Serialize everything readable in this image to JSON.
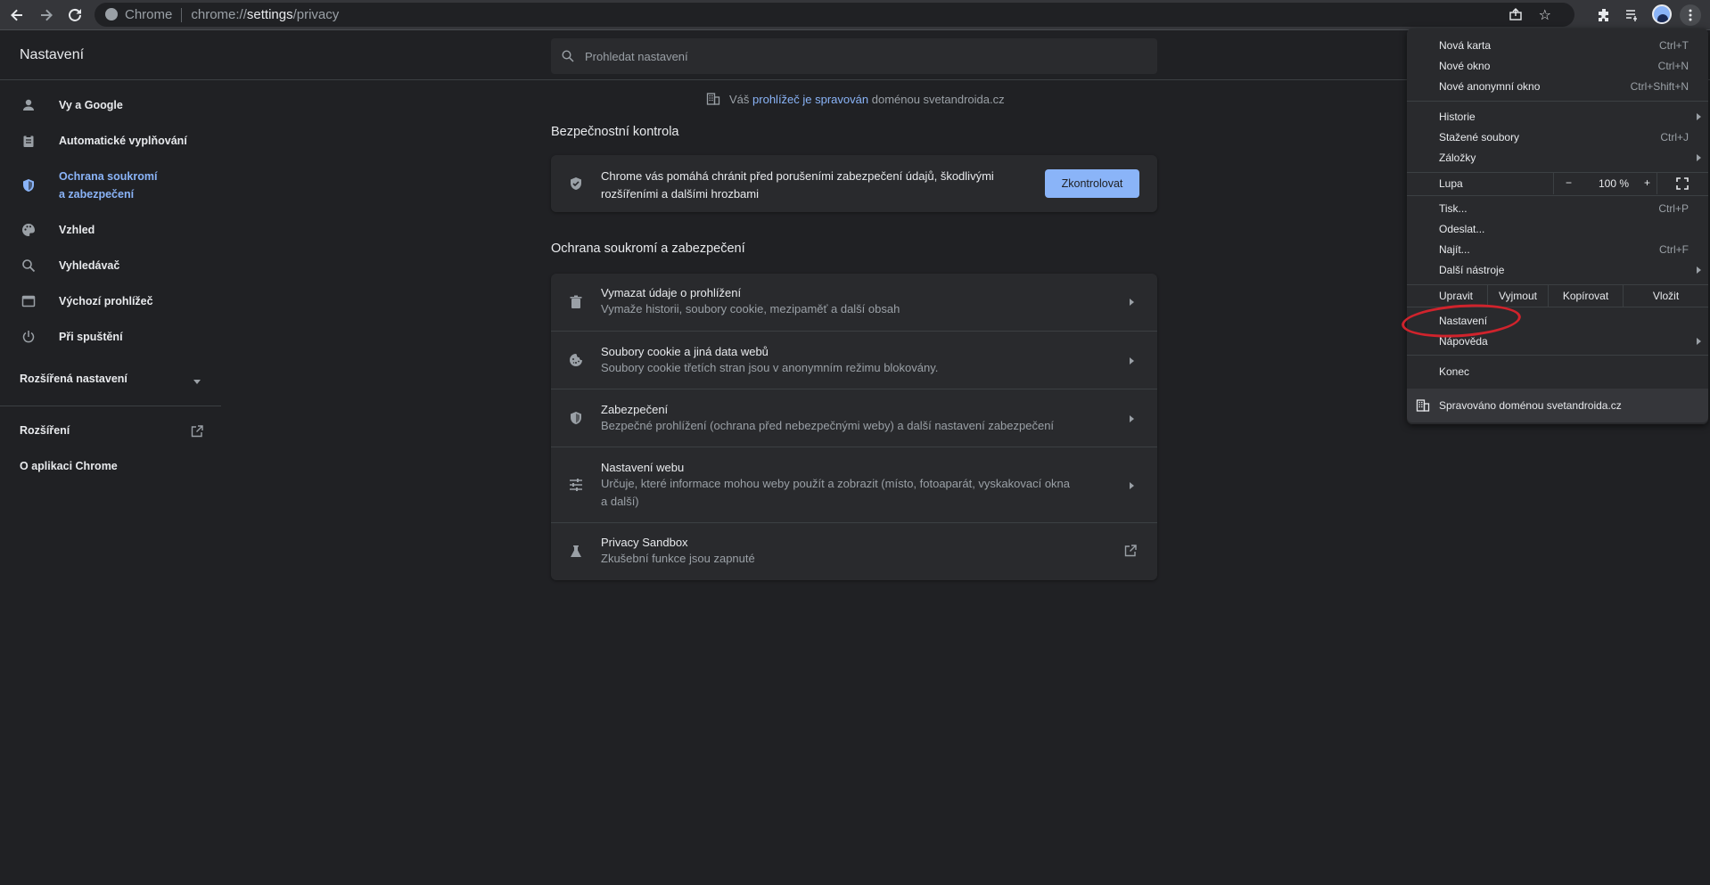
{
  "browser": {
    "site_label": "Chrome",
    "url_scheme": "chrome://",
    "url_host": "settings",
    "url_path": "/privacy"
  },
  "header": {
    "title": "Nastavení",
    "search_placeholder": "Prohledat nastavení"
  },
  "sidebar": {
    "items": [
      {
        "label": "Vy a Google",
        "icon": "person-icon"
      },
      {
        "label": "Automatické vyplňování",
        "icon": "clipboard-icon"
      },
      {
        "label": "Ochrana soukromí",
        "label2": "a zabezpečení",
        "icon": "shield-icon"
      },
      {
        "label": "Vzhled",
        "icon": "palette-icon"
      },
      {
        "label": "Vyhledávač",
        "icon": "search-icon"
      },
      {
        "label": "Výchozí prohlížeč",
        "icon": "browser-icon"
      },
      {
        "label": "Při spuštění",
        "icon": "power-icon"
      }
    ],
    "advanced": "Rozšířená nastavení",
    "extensions": "Rozšíření",
    "about": "O aplikaci Chrome"
  },
  "managed_notice": {
    "prefix": "Váš",
    "link": "prohlížeč je spravován",
    "suffix": "doménou svetandroida.cz"
  },
  "safety_check": {
    "title": "Bezpečnostní kontrola",
    "text": "Chrome vás pomáhá chránit před porušeními zabezpečení údajů, škodlivými rozšířeními a dalšími hrozbami",
    "button": "Zkontrolovat"
  },
  "privacy": {
    "title": "Ochrana soukromí a zabezpečení",
    "rows": [
      {
        "title": "Vymazat údaje o prohlížení",
        "sub": "Vymaže historii, soubory cookie, mezipaměť a další obsah"
      },
      {
        "title": "Soubory cookie a jiná data webů",
        "sub": "Soubory cookie třetích stran jsou v anonymním režimu blokovány."
      },
      {
        "title": "Zabezpečení",
        "sub": "Bezpečné prohlížení (ochrana před nebezpečnými weby) a další nastavení zabezpečení"
      },
      {
        "title": "Nastavení webu",
        "sub": "Určuje, které informace mohou weby použít a zobrazit (místo, fotoaparát, vyskakovací okna a další)"
      },
      {
        "title": "Privacy Sandbox",
        "sub": "Zkušební funkce jsou zapnuté"
      }
    ]
  },
  "menu": {
    "new_tab": {
      "label": "Nová karta",
      "shortcut": "Ctrl+T"
    },
    "new_window": {
      "label": "Nové okno",
      "shortcut": "Ctrl+N"
    },
    "new_incognito": {
      "label": "Nové anonymní okno",
      "shortcut": "Ctrl+Shift+N"
    },
    "history": {
      "label": "Historie"
    },
    "downloads": {
      "label": "Stažené soubory",
      "shortcut": "Ctrl+J"
    },
    "bookmarks": {
      "label": "Záložky"
    },
    "zoom": {
      "label": "Lupa",
      "minus": "−",
      "value": "100 %",
      "plus": "+"
    },
    "print": {
      "label": "Tisk...",
      "shortcut": "Ctrl+P"
    },
    "cast": {
      "label": "Odeslat..."
    },
    "find": {
      "label": "Najít...",
      "shortcut": "Ctrl+F"
    },
    "more_tools": {
      "label": "Další nástroje"
    },
    "edit": {
      "label": "Upravit",
      "cut": "Vyjmout",
      "copy": "Kopírovat",
      "paste": "Vložit"
    },
    "settings": {
      "label": "Nastavení"
    },
    "help": {
      "label": "Nápověda"
    },
    "exit": {
      "label": "Konec"
    },
    "managed": {
      "label": "Spravováno doménou svetandroida.cz"
    }
  }
}
